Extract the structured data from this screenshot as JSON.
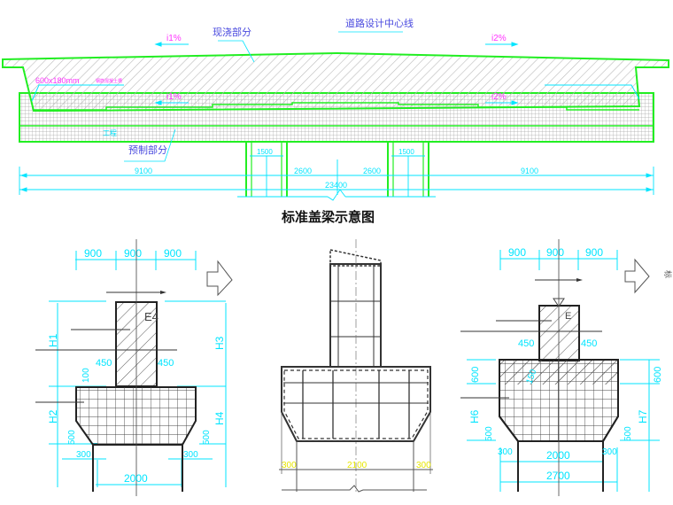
{
  "title": "标准盖梁示意图",
  "colors": {
    "outline_green": "#22ee22",
    "dimension_cyan": "#00e5ff",
    "slope_magenta": "#ff33ff",
    "label_blue": "#4a4adf",
    "structure_black": "#222222",
    "dimension_yellow": "#e6e600"
  },
  "top_section": {
    "label_cast_in_place": "现浇部分",
    "label_centerline": "道路设计中心线",
    "label_precast": "预制部分",
    "slope_left_top": "i1%",
    "slope_right_top": "i2%",
    "slope_left_bottom": "i1%",
    "slope_right_bottom": "i2%",
    "groove_label": "600x180mm",
    "groove_note": "钢筋混凝土槽",
    "small_label": "工程",
    "dims": {
      "left_span": "9100",
      "right_span": "9100",
      "pier_left": "1500",
      "pier_right": "1500",
      "center_left": "2600",
      "center_right": "2600",
      "total": "23400"
    }
  },
  "left_view": {
    "top_dims": [
      "900",
      "900",
      "900"
    ],
    "tag": "E4",
    "h_labels": {
      "h1": "H1",
      "h2": "H2",
      "h3": "H3",
      "h4": "H4"
    },
    "dims": {
      "shoulder_left": "450",
      "shoulder_right": "450",
      "notch": "100",
      "chamfer_left": "500",
      "chamfer_right": "500",
      "offset_left": "300",
      "offset_right": "300",
      "base_width": "2000"
    }
  },
  "middle_view": {
    "dims": {
      "left": "300",
      "center": "2100",
      "right": "300"
    }
  },
  "right_view": {
    "top_dims": [
      "900",
      "900",
      "900"
    ],
    "tag": "E",
    "h_labels": {
      "h6": "H6",
      "h7": "H7"
    },
    "side_char": "标",
    "dims": {
      "shoulder_left": "450",
      "shoulder_right": "450",
      "cap_left": "600",
      "cap_right": "600",
      "notch": "150",
      "chamfer_left": "500",
      "chamfer_right": "500",
      "offset_left": "300",
      "offset_right": "300",
      "base_width": "2000",
      "total_width": "2700"
    }
  }
}
